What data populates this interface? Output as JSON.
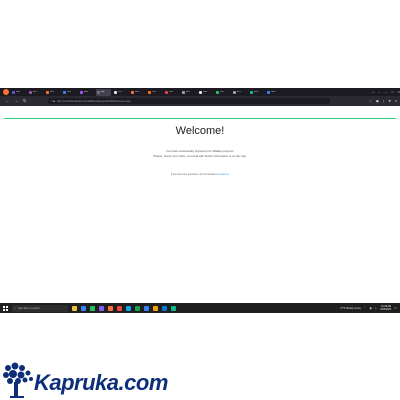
{
  "browser": {
    "tabs": [
      {
        "label": "Kap",
        "color": "#5b5bd6"
      },
      {
        "label": "All P",
        "color": "#9b59b6"
      },
      {
        "label": "Seo",
        "color": "#ff7139"
      },
      {
        "label": "Seo",
        "color": "#3b82f6"
      },
      {
        "label": "Alex",
        "color": "#a855f7"
      },
      {
        "label": "Wo",
        "color": "#6b7280"
      },
      {
        "label": "Chr",
        "color": "#e5e7eb"
      },
      {
        "label": "Seo",
        "color": "#ff7139"
      },
      {
        "label": "Jan",
        "color": "#f97316"
      },
      {
        "label": "Latt",
        "color": "#ef4444"
      },
      {
        "label": "Hov",
        "color": "#9ca3af"
      },
      {
        "label": "Hert",
        "color": "#e5e7eb"
      },
      {
        "label": "Jau",
        "color": "#22c55e"
      },
      {
        "label": "All P",
        "color": "#9ca3af"
      },
      {
        "label": "Bost",
        "color": "#14b8a6"
      },
      {
        "label": "New",
        "color": "#3b82f6"
      }
    ],
    "active_tab_index": 5,
    "new_tab_label": "+",
    "tab_list_label": "⌄",
    "url": "http://merchant.kapruka.com/affiliatesSignupStatAffiliateSuccess.aspx",
    "window_controls": [
      "—",
      "□",
      "✕"
    ]
  },
  "page": {
    "heading": "Welcome!",
    "line1": "You have successfully signed up for affiliate program.",
    "line2": "Please, check your inbox, an email with further information is on the way.",
    "contact_prefix": "If you have any questions, do not hesitate to",
    "contact_link": "contact us"
  },
  "taskbar": {
    "search_placeholder": "Type here to search",
    "apps": [
      "#f0c040",
      "#3b82f6",
      "#22c55e",
      "#8b5cf6",
      "#ff7139",
      "#ef4444",
      "#0ea5e9",
      "#16a34a",
      "#3b82f6",
      "#f59e0b",
      "#0078d4",
      "#10b981"
    ],
    "weather": "27°F  Mostly sunny",
    "time": "10:46 AM",
    "date": "8/23/2022"
  },
  "logo": {
    "text": "Kapruka.com",
    "color": "#0d2f7a"
  }
}
